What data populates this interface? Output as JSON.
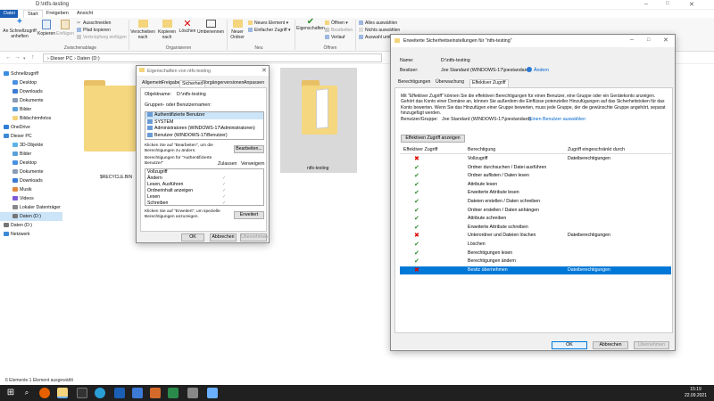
{
  "window": {
    "title": "D:\\ntfs-testing"
  },
  "ribbon_tabs": [
    "Datei",
    "Start",
    "Freigeben",
    "Ansicht"
  ],
  "ribbon": {
    "pin": "An Schnellzugriff anheften",
    "copy": "Kopieren",
    "paste": "Einfügen",
    "cut": "Ausschneiden",
    "copy_path": "Pfad kopieren",
    "paste_link": "Verknüpfung einfügen",
    "move_to": "Verschieben nach",
    "copy_to": "Kopieren nach",
    "delete": "Löschen",
    "rename": "Umbenennen",
    "new_folder": "Neuer Ordner",
    "new_item": "Neues Element",
    "easy_access": "Einfacher Zugriff",
    "properties": "Eigenschaften",
    "open": "Öffnen",
    "edit": "Bearbeiten",
    "history": "Verlauf",
    "select_all": "Alles auswählen",
    "select_none": "Nichts auswählen",
    "invert": "Auswahl umkehren",
    "grp_clipboard": "Zwischenablage",
    "grp_organize": "Organisieren",
    "grp_new": "Neu",
    "grp_open": "Öffnen"
  },
  "address": "› Dieser PC › Daten (D:)",
  "nav": [
    {
      "label": "Schnellzugriff",
      "indent": 1,
      "color": "#3b8de0"
    },
    {
      "label": "Desktop",
      "indent": 2,
      "color": "#4a90e2"
    },
    {
      "label": "Downloads",
      "indent": 2,
      "color": "#3a7bd5"
    },
    {
      "label": "Dokumente",
      "indent": 2,
      "color": "#8a9bb5"
    },
    {
      "label": "Bilder",
      "indent": 2,
      "color": "#5aa0d8"
    },
    {
      "label": "Bildschirmfotos",
      "indent": 2,
      "color": "#f4d47c"
    },
    {
      "label": "OneDrive",
      "indent": 1,
      "color": "#2d7fd6"
    },
    {
      "label": "Dieser PC",
      "indent": 1,
      "color": "#3c8ad5"
    },
    {
      "label": "3D-Objekte",
      "indent": 2,
      "color": "#5db3e8"
    },
    {
      "label": "Bilder",
      "indent": 2,
      "color": "#5aa0d8"
    },
    {
      "label": "Desktop",
      "indent": 2,
      "color": "#4a90e2"
    },
    {
      "label": "Dokumente",
      "indent": 2,
      "color": "#8a9bb5"
    },
    {
      "label": "Downloads",
      "indent": 2,
      "color": "#3a7bd5"
    },
    {
      "label": "Musik",
      "indent": 2,
      "color": "#e08a3b"
    },
    {
      "label": "Videos",
      "indent": 2,
      "color": "#7c5ad8"
    },
    {
      "label": "Lokaler Datenträger",
      "indent": 2,
      "color": "#888"
    },
    {
      "label": "Daten (D:)",
      "indent": 2,
      "color": "#777",
      "selected": true
    },
    {
      "label": "Daten (D:)",
      "indent": 1,
      "color": "#777"
    },
    {
      "label": "Netzwerk",
      "indent": 1,
      "color": "#3c8ad5"
    }
  ],
  "files": [
    {
      "name": "$RECYCLE.BIN"
    },
    {
      "name": "ntfs-testing"
    }
  ],
  "status": "6 Elemente     1 Element ausgewählt",
  "clock": {
    "time": "15:19",
    "date": "22.09.2021"
  },
  "props": {
    "title": "Eigenschaften von ntfs-testing",
    "tabs": [
      "Allgemein",
      "Freigabe",
      "Sicherheit",
      "Vorgängerversionen",
      "Anpassen"
    ],
    "object_label": "Objektname:",
    "object_value": "D:\\ntfs-testing",
    "groups_label": "Gruppen- oder Benutzernamen:",
    "groups": [
      "Authentifizierte Benutzer",
      "SYSTEM",
      "Administratoren (WINDOWS-17\\Administratoren)",
      "Benutzer (WINDOWS-17\\Benutzer)"
    ],
    "edit_hint": "Klicken Sie auf \"Bearbeiten\", um die Berechtigungen zu ändern.",
    "edit_btn": "Bearbeiten...",
    "perm_label": "Berechtigungen für \"Authentifizierte Benutzer\"",
    "allow": "Zulassen",
    "deny": "Verweigern",
    "perms": [
      "Vollzugriff",
      "Ändern",
      "Lesen, Ausführen",
      "Ordnerinhalt anzeigen",
      "Lesen",
      "Schreiben"
    ],
    "perm_allowed": [
      false,
      true,
      true,
      true,
      true,
      true
    ],
    "adv_hint": "Klicken Sie auf \"Erweitert\", um spezielle Berechtigungen anzuzeigen.",
    "adv_btn": "Erweitert",
    "ok": "OK",
    "cancel": "Abbrechen",
    "apply": "Übernehmen"
  },
  "adv": {
    "title": "Erweiterte Sicherheitseinstellungen für \"ntfs-testing\"",
    "name_label": "Name:",
    "name_value": "D:\\ntfs-testing",
    "owner_label": "Besitzer:",
    "owner_value": "Joe Standard (WINDOWS-17\\joestandard)",
    "owner_change": "Ändern",
    "tabs": [
      "Berechtigungen",
      "Überwachung",
      "Effektiver Zugriff"
    ],
    "desc": "Mit \"Effektiver Zugriff\" können Sie die effektiven Berechtigungen für einen Benutzer, eine Gruppe oder ein Gerätekonto anzeigen. Gehört das Konto einer Domäne an, können Sie außerdem die Einflüsse potenzieller Hinzufügungen auf das Sicherheitstoken für das Konto bewerten. Wenn Sie das Hinzufügen einer Gruppe bewerten, muss jede Gruppe, der die gewünschte Gruppe angehört, separat hinzugefügt werden.",
    "user_label": "Benutzer/Gruppe:",
    "user_value": "Joe Standard (WINDOWS-17\\joestandard)",
    "user_select": "Einen Benutzer auswählen",
    "view_btn": "Effektiven Zugriff anzeigen",
    "col_access": "Effektiver Zugriff",
    "col_perm": "Berechtigung",
    "col_limit": "Zugriff eingeschränkt durch",
    "rows": [
      {
        "allowed": false,
        "perm": "Vollzugriff",
        "limit": "Dateiberechtigungen"
      },
      {
        "allowed": true,
        "perm": "Ordner durchsuchen / Datei ausführen",
        "limit": ""
      },
      {
        "allowed": true,
        "perm": "Ordner auflisten / Daten lesen",
        "limit": ""
      },
      {
        "allowed": true,
        "perm": "Attribute lesen",
        "limit": ""
      },
      {
        "allowed": true,
        "perm": "Erweiterte Attribute lesen",
        "limit": ""
      },
      {
        "allowed": true,
        "perm": "Dateien erstellen / Daten schreiben",
        "limit": ""
      },
      {
        "allowed": true,
        "perm": "Ordner erstellen / Daten anhängen",
        "limit": ""
      },
      {
        "allowed": true,
        "perm": "Attribute schreiben",
        "limit": ""
      },
      {
        "allowed": true,
        "perm": "Erweiterte Attribute schreiben",
        "limit": ""
      },
      {
        "allowed": false,
        "perm": "Unterordner und Dateien löschen",
        "limit": "Dateiberechtigungen"
      },
      {
        "allowed": true,
        "perm": "Löschen",
        "limit": ""
      },
      {
        "allowed": true,
        "perm": "Berechtigungen lesen",
        "limit": ""
      },
      {
        "allowed": true,
        "perm": "Berechtigungen ändern",
        "limit": ""
      },
      {
        "allowed": false,
        "perm": "Besitz übernehmen",
        "limit": "Dateiberechtigungen",
        "selected": true
      }
    ],
    "ok": "OK",
    "cancel": "Abbrechen",
    "apply": "Übernehmen"
  }
}
